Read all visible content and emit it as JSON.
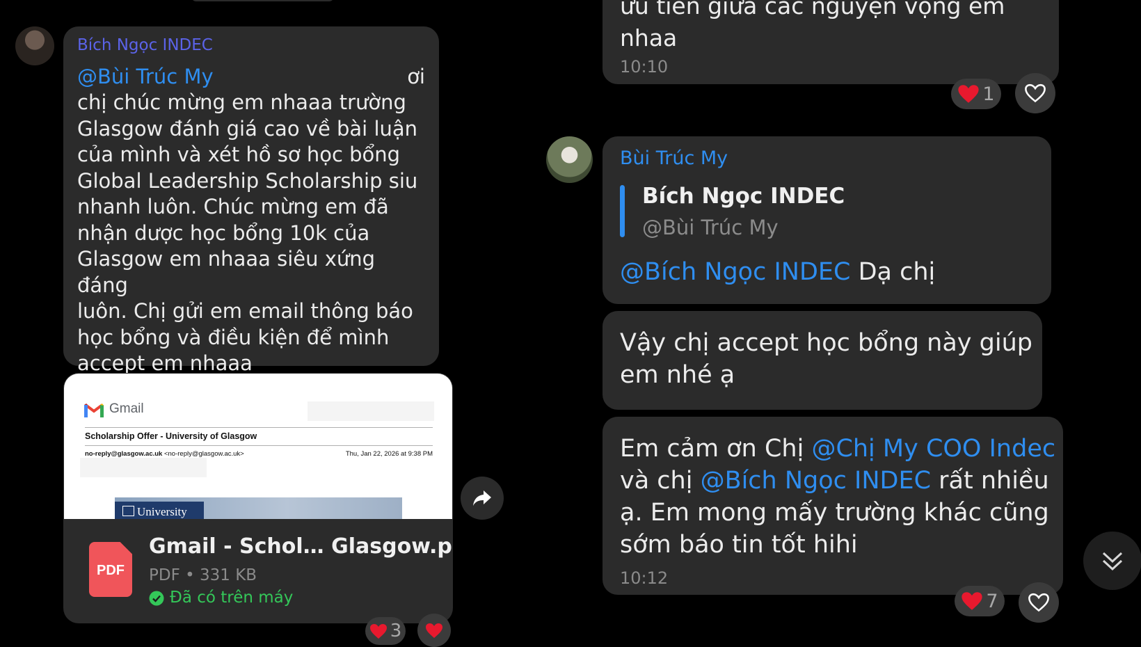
{
  "left_message": {
    "sender": "Bích Ngọc INDEC",
    "mention": "@Bùi Trúc My",
    "suffix": "ơi",
    "lines": [
      "chị chúc mừng em nhaaa trường",
      "Glasgow đánh giá cao về bài luận",
      "của mình và xét hồ sơ học bổng",
      "Global Leadership Scholarship siu",
      "nhanh luôn. Chúc mừng em đã",
      "nhận dược học bổng 10k của",
      "Glasgow em nhaaa siêu xứng đáng",
      "luôn. Chị gửi em email thông báo",
      "học bổng và điều kiện để mình",
      "accept em nhaaa"
    ]
  },
  "preview": {
    "gmail_label": "Gmail",
    "subject": "Scholarship Offer - University of Glasgow",
    "from_name": "no-reply@glasgow.ac.uk",
    "from_addr": "<no-reply@glasgow.ac.uk>",
    "date": "Thu, Jan 22, 2026 at 9:38 PM",
    "banner_text": "University"
  },
  "file": {
    "icon_label": "PDF",
    "name": "Gmail - Schol… Glasgow.pdf",
    "meta": "PDF • 331 KB",
    "status": "Đã có trên máy"
  },
  "left_reactions": {
    "count": "3"
  },
  "top_right": {
    "line1": "ưu tiên giữa các nguyện vọng em",
    "line2": "nhaa",
    "time": "10:10",
    "reaction_count": "1"
  },
  "reply_message": {
    "sender": "Bùi Trúc My",
    "quote_name": "Bích Ngọc INDEC",
    "quote_text": "@Bùi Trúc My",
    "mention": "@Bích Ngọc INDEC",
    "text": " Dạ chị"
  },
  "accept_message": {
    "line1": "Vậy chị accept học bổng này giúp",
    "line2": "em nhé ạ"
  },
  "thanks_message": {
    "t1": "Em cảm ơn Chị ",
    "m1": "@Chị My COO Indec",
    "t2": "và chị ",
    "m2": "@Bích Ngọc INDEC",
    "t3": " rất nhiều",
    "line3": "ạ. Em mong mấy trường khác cũng",
    "line4": "sớm báo tin tốt hihi",
    "time": "10:12",
    "reaction_count": "7"
  },
  "colors": {
    "background": "#000000",
    "bubble": "#2b2b2b",
    "mention": "#2f8ef0",
    "sender_left": "#5b63e8",
    "sender_right": "#2f8ef0",
    "pdf_red": "#f0555a",
    "success_green": "#34c759"
  }
}
